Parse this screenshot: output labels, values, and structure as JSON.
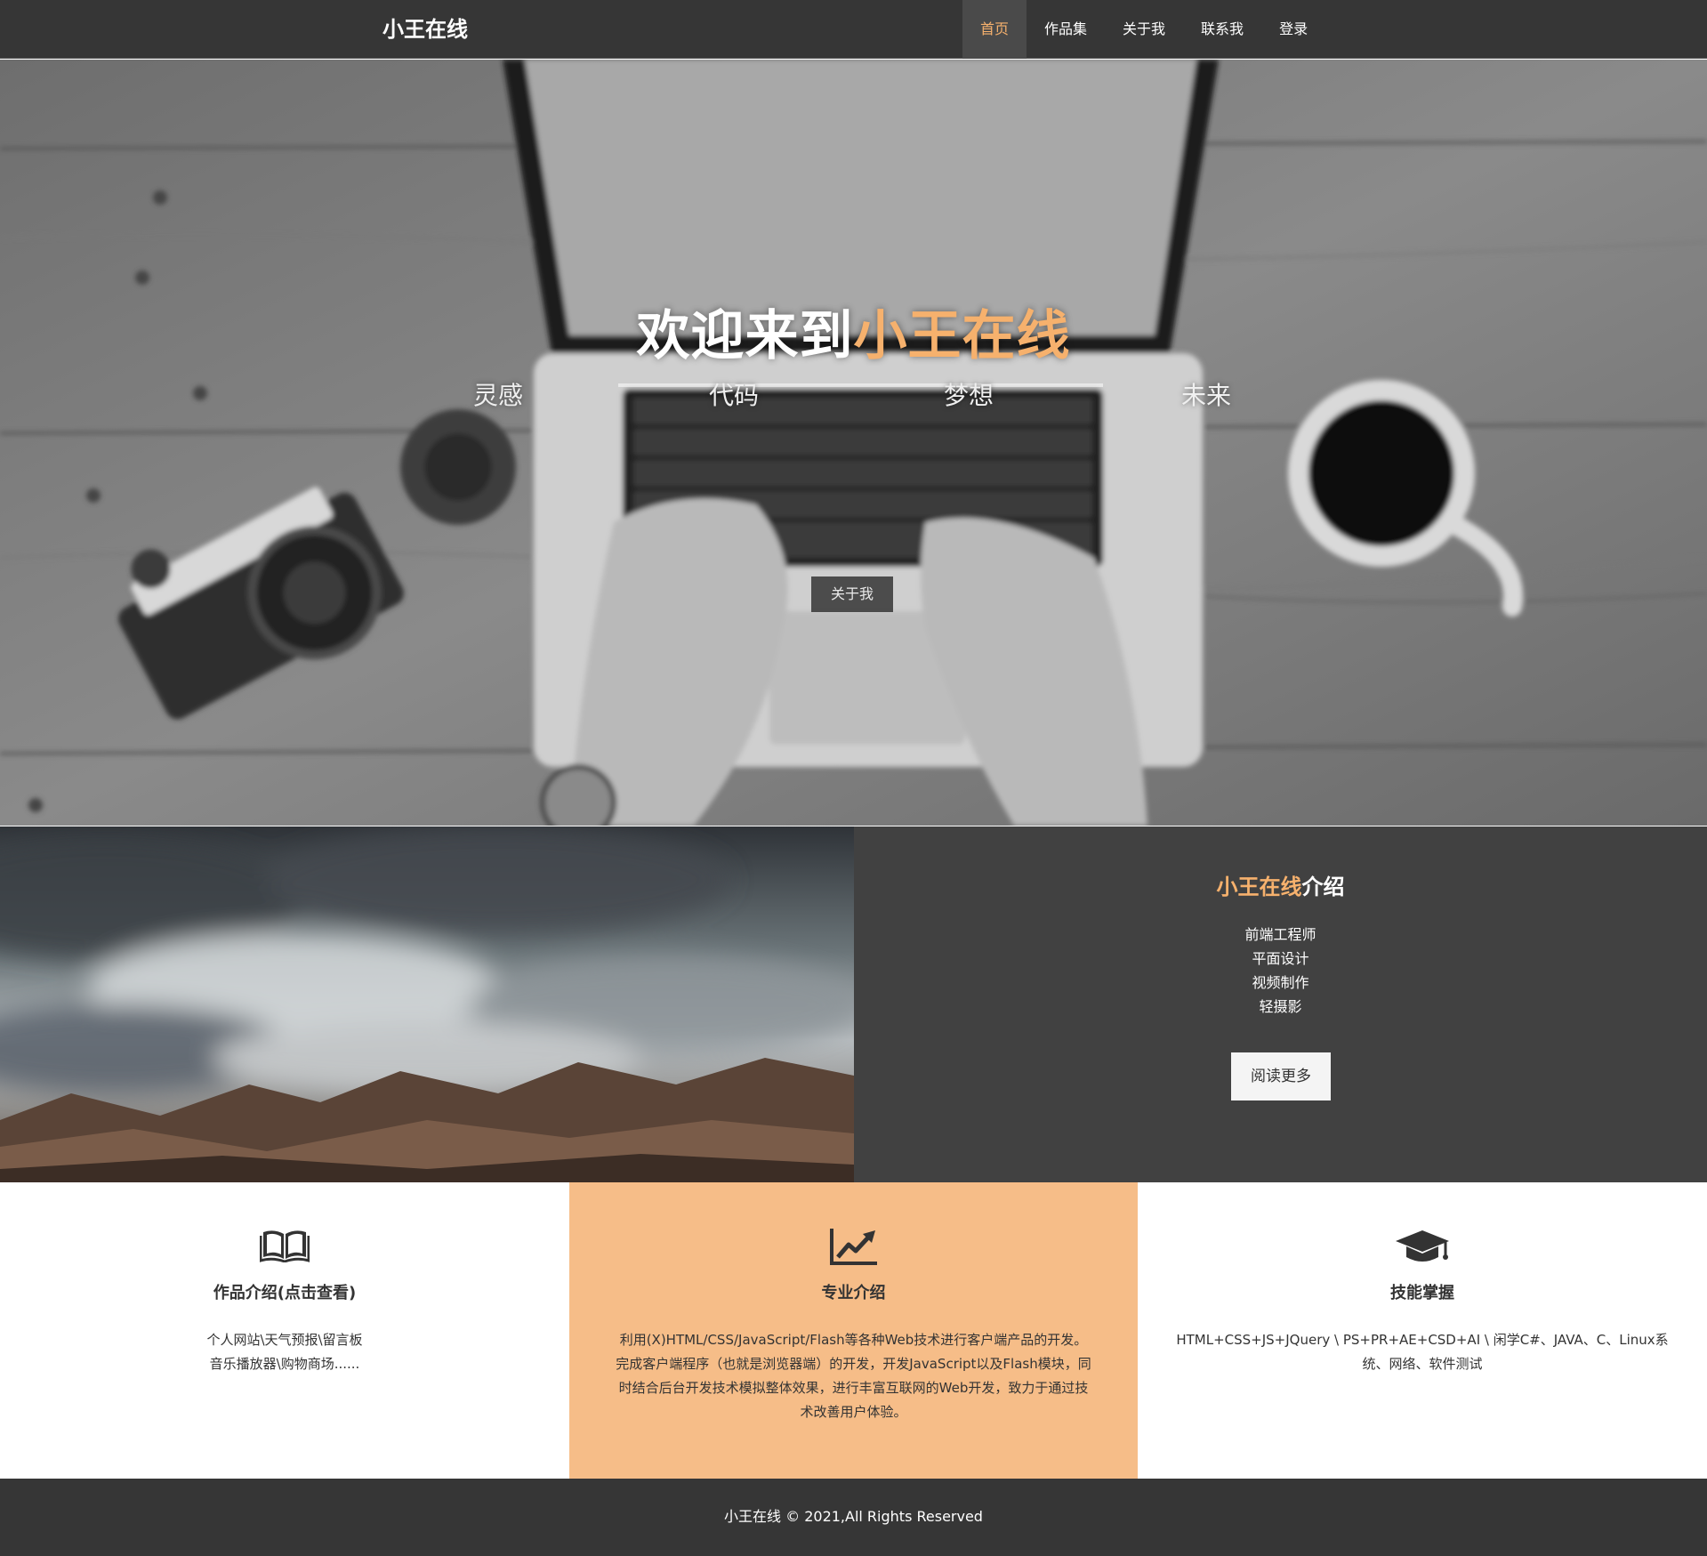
{
  "brand": {
    "name": "小王在线"
  },
  "nav": {
    "items": [
      {
        "label": "首页"
      },
      {
        "label": "作品集"
      },
      {
        "label": "关于我"
      },
      {
        "label": "联系我"
      },
      {
        "label": "登录"
      }
    ]
  },
  "hero": {
    "title_prefix": "欢迎来到",
    "title_accent": "小王在线",
    "tags": [
      "灵感",
      "代码",
      "梦想",
      "未来"
    ],
    "button_label": "关于我"
  },
  "about": {
    "title_accent": "小王在线",
    "title_suffix": "介绍",
    "items": [
      "前端工程师",
      "平面设计",
      "视频制作",
      "轻摄影"
    ],
    "read_more_label": "阅读更多"
  },
  "features": [
    {
      "icon": "book-icon",
      "title": "作品介绍(点击查看)",
      "text": "个人网站\\天气预报\\留言板\n音乐播放器\\购物商场......"
    },
    {
      "icon": "chart-line-icon",
      "title": "专业介绍",
      "text": "利用(X)HTML/CSS/JavaScript/Flash等各种Web技术进行客户端产品的开发。完成客户端程序（也就是浏览器端）的开发，开发JavaScript以及Flash模块，同时结合后台开发技术模拟整体效果，进行丰富互联网的Web开发，致力于通过技术改善用户体验。"
    },
    {
      "icon": "graduation-cap-icon",
      "title": "技能掌握",
      "text": "HTML+CSS+JS+JQuery \\ PS+PR+AE+CSD+AI \\ 闲学C#、JAVA、C、Linux系统、网络、软件测试"
    }
  ],
  "footer": {
    "text": "小王在线 © 2021,All Rights Reserved"
  },
  "colors": {
    "accent": "#f6b16d",
    "nav_bg": "#363636",
    "panel_bg": "#414141",
    "feature_highlight": "#f6bd88"
  }
}
